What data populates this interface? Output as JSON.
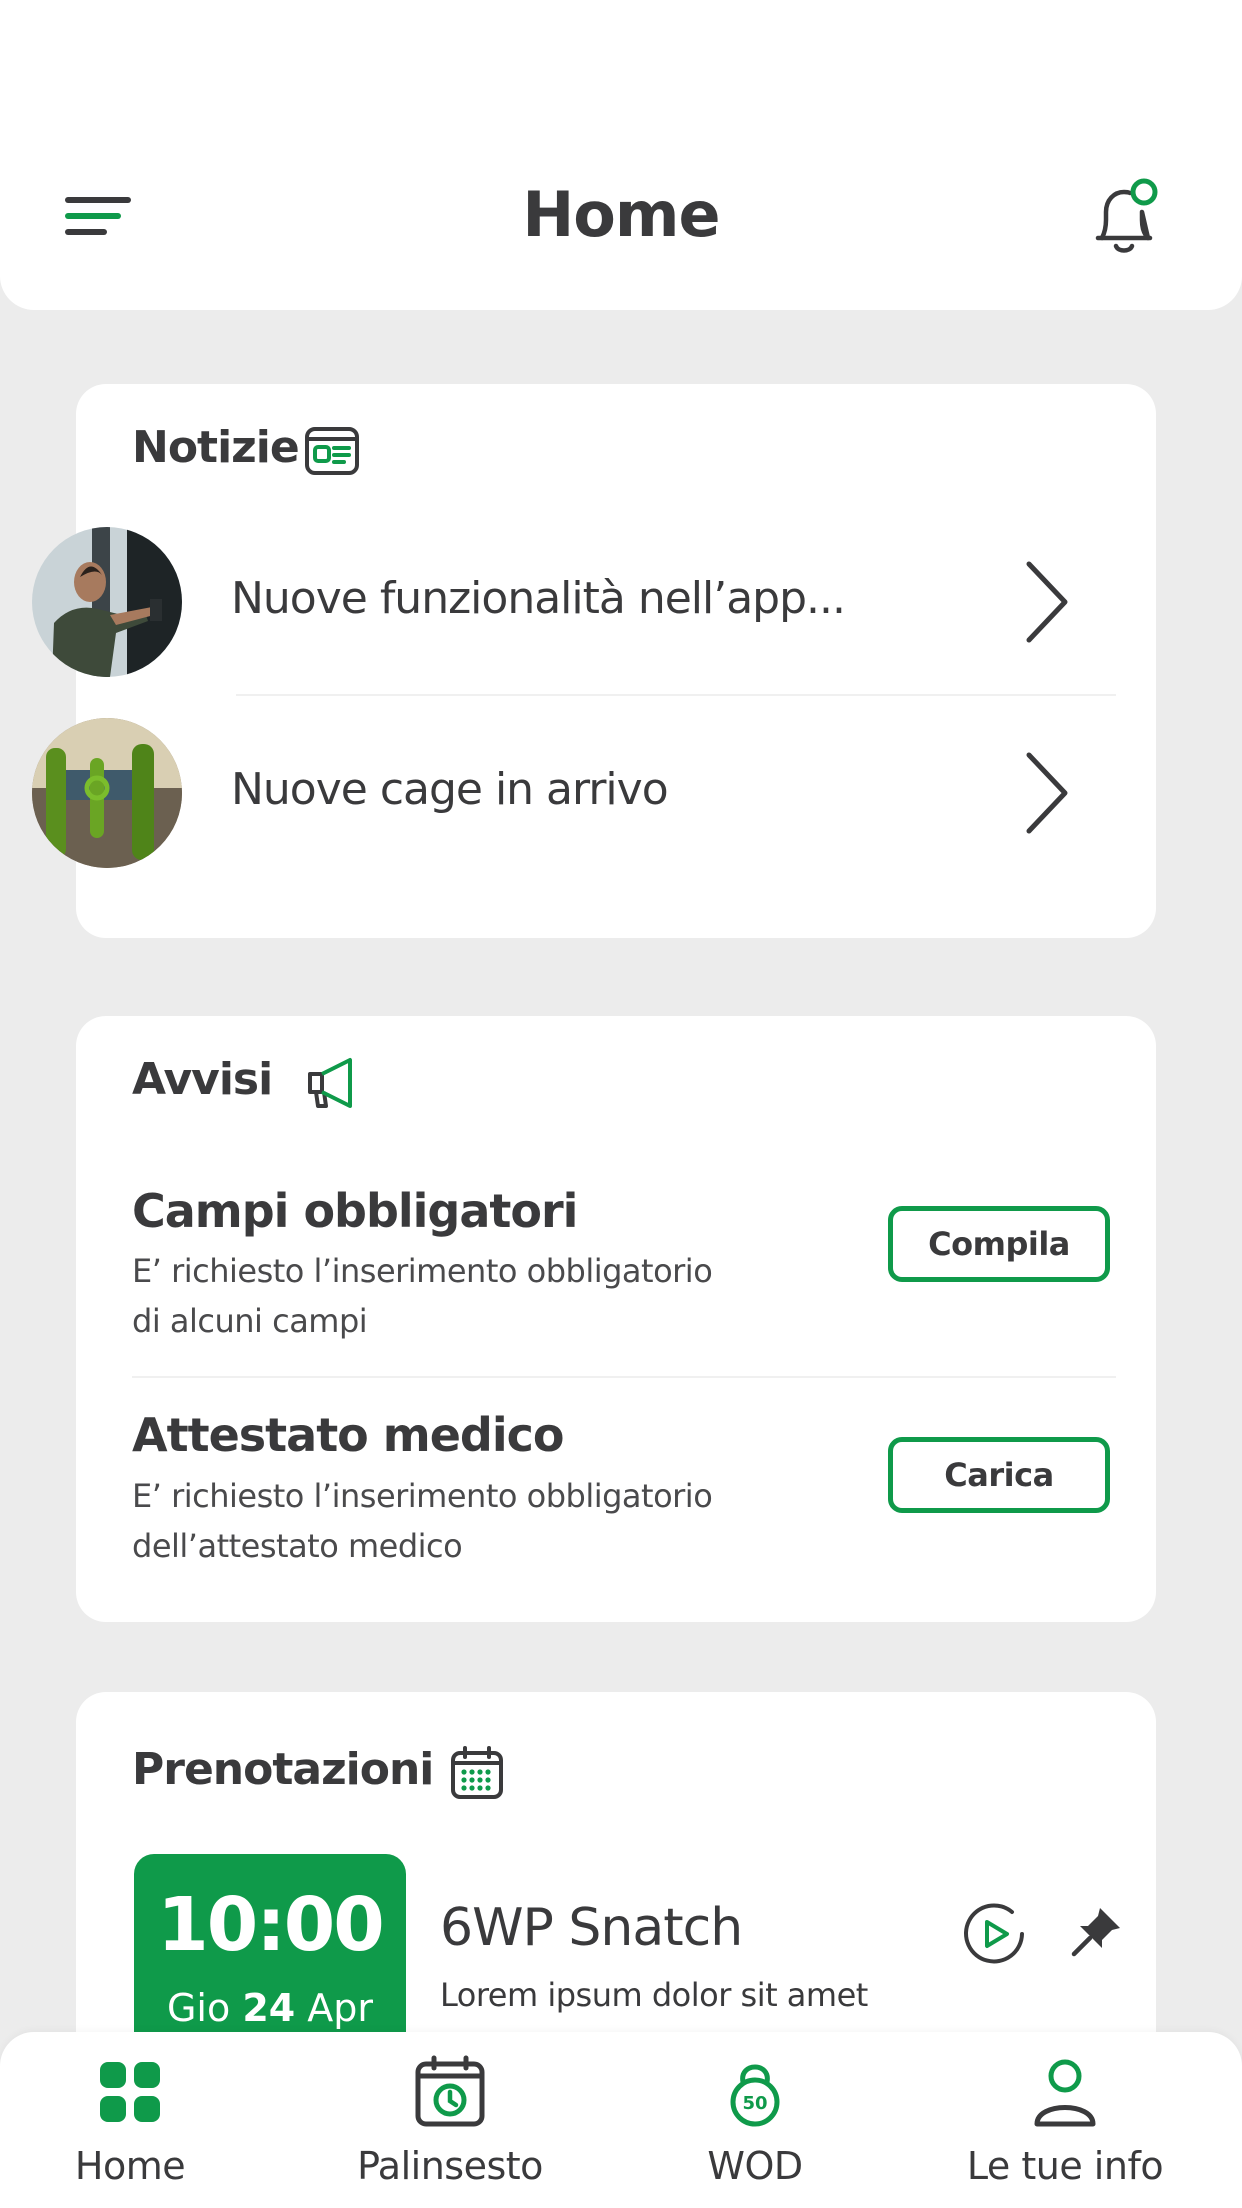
{
  "header": {
    "title": "Home",
    "menu_icon": "menu-icon",
    "bell_icon": "bell-icon"
  },
  "news": {
    "title": "Notizie",
    "icon": "newspaper-icon",
    "items": [
      {
        "label": "Nuove funzionalità nell’app..."
      },
      {
        "label": "Nuove cage in arrivo"
      }
    ]
  },
  "notices": {
    "title": "Avvisi",
    "icon": "megaphone-icon",
    "items": [
      {
        "title": "Campi obbligatori",
        "description": "E’ richiesto l’inserimento obbligatorio di alcuni campi",
        "button": "Compila"
      },
      {
        "title": "Attestato medico",
        "description": "E’ richiesto l’inserimento obbligatorio dell’attestato medico",
        "button": "Carica"
      }
    ]
  },
  "bookings": {
    "title": "Prenotazioni",
    "icon": "calendar-icon",
    "item": {
      "time": "10:00",
      "day": "Gio",
      "date": "24",
      "month": "Apr",
      "class_name": "6WP Snatch",
      "subtitle": "Lorem ipsum dolor sit amet"
    }
  },
  "tabs": [
    {
      "label": "Home",
      "icon": "grid-icon",
      "active": true
    },
    {
      "label": "Palinsesto",
      "icon": "calendar-clock-icon",
      "active": false
    },
    {
      "label": "WOD",
      "icon": "kettlebell-icon",
      "active": false,
      "badge": "50"
    },
    {
      "label": "Le tue info",
      "icon": "user-icon",
      "active": false
    }
  ],
  "colors": {
    "accent": "#0f9a4a",
    "background": "#ececec",
    "text": "#3a3a3c"
  }
}
